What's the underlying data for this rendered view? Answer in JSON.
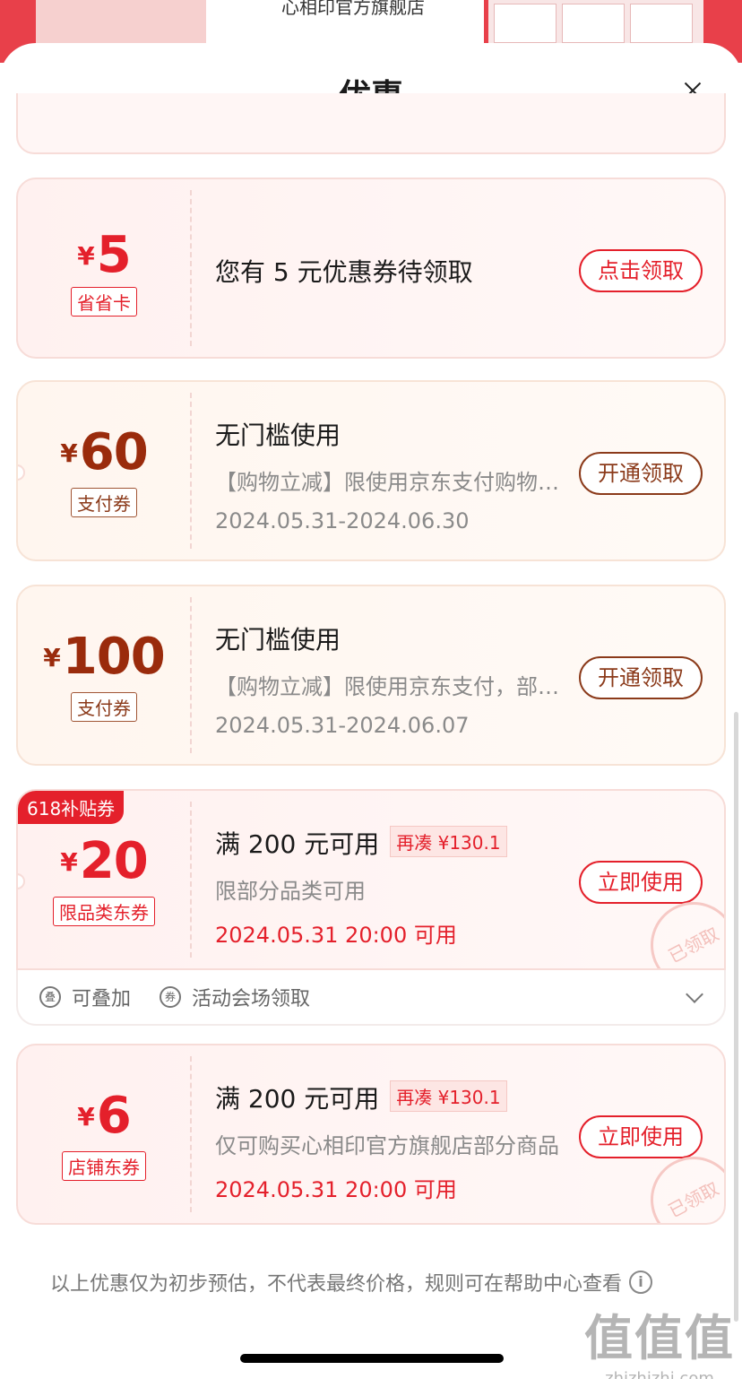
{
  "background": {
    "store_name": "心相印官方旗舰店"
  },
  "sheet": {
    "title": "优惠"
  },
  "coupons": [
    {
      "yen": "¥",
      "amount": "5",
      "tag": "省省卡",
      "title": "您有 5 元优惠券待领取",
      "button": "点击领取"
    },
    {
      "yen": "¥",
      "amount": "60",
      "tag": "支付券",
      "title": "无门槛使用",
      "desc": "【购物立减】限使用京东支付购物满一定金额可用",
      "date": "2024.05.31-2024.06.30",
      "button": "开通领取"
    },
    {
      "yen": "¥",
      "amount": "100",
      "tag": "支付券",
      "title": "无门槛使用",
      "desc": "【购物立减】限使用京东支付，部分商品可用",
      "date": "2024.05.31-2024.06.07",
      "button": "开通领取"
    },
    {
      "badge": "618补贴券",
      "yen": "¥",
      "amount": "20",
      "tag": "限品类东券",
      "title": "满 200 元可用",
      "pill": "再凑 ¥130.1",
      "desc": "限部分品类可用",
      "date": "2024.05.31 20:00 可用",
      "button": "立即使用",
      "stamp": "已领取",
      "footer": {
        "stackable": "可叠加",
        "stackable_icon": "叠",
        "source": "活动会场领取",
        "source_icon": "券"
      }
    },
    {
      "yen": "¥",
      "amount": "6",
      "tag": "店铺东券",
      "title": "满 200 元可用",
      "pill": "再凑 ¥130.1",
      "desc": "仅可购买心相印官方旗舰店部分商品",
      "date": "2024.05.31 20:00 可用",
      "button": "立即使用",
      "stamp": "已领取"
    }
  ],
  "disclaimer": {
    "text": "以上优惠仅为初步预估，不代表最终价格，规则可在帮助中心查看",
    "icon": "i"
  },
  "watermark": {
    "big": "值值值",
    "small": "zhizhizhi.com"
  }
}
